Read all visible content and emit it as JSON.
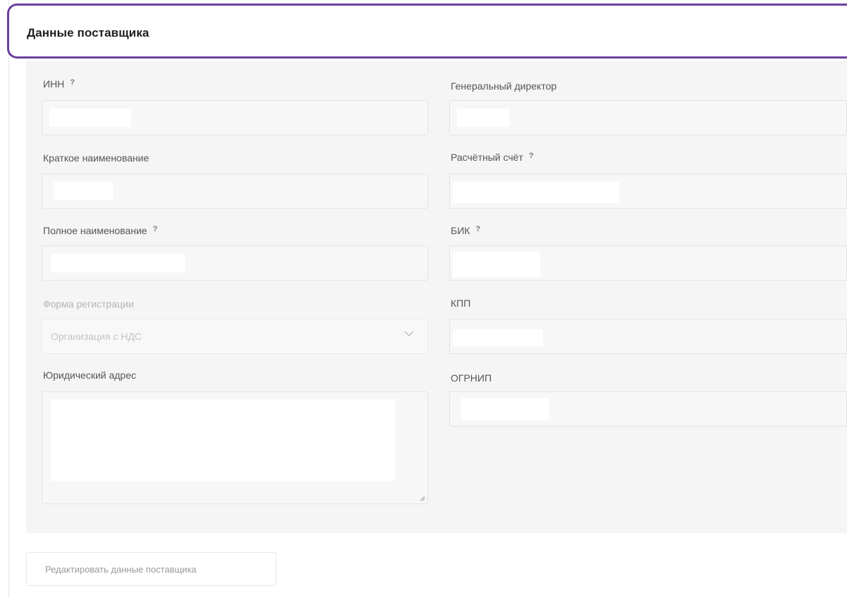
{
  "header": {
    "title": "Данные поставщика"
  },
  "fields": {
    "inn": {
      "label": "ИНН",
      "help": "?"
    },
    "general_director": {
      "label": "Генеральный директор"
    },
    "short_name": {
      "label": "Краткое наименование"
    },
    "settlement_account": {
      "label": "Расчётный счёт",
      "help": "?"
    },
    "full_name": {
      "label": "Полное наименование",
      "help": "?"
    },
    "bik": {
      "label": "БИК",
      "help": "?"
    },
    "registration_form": {
      "label": "Форма регистрации",
      "value": "Организация с НДС"
    },
    "kpp": {
      "label": "КПП"
    },
    "legal_address": {
      "label": "Юридический адрес"
    },
    "ogrnip": {
      "label": "ОГРНИП"
    }
  },
  "actions": {
    "edit_label": "Редактировать данные поставщика"
  },
  "colors": {
    "accent": "#6b3fa0",
    "panel": "#f5f5f5"
  }
}
